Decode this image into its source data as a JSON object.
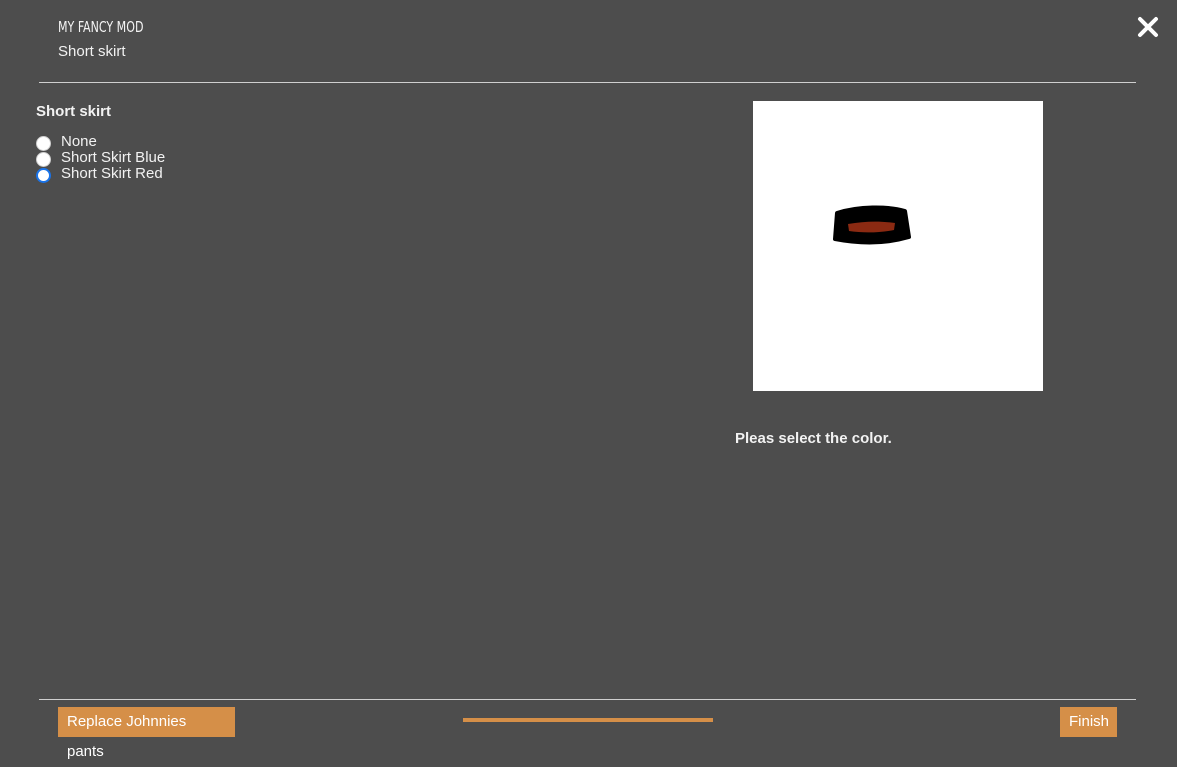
{
  "header": {
    "title": "My Fancy Mod",
    "subtitle": "Short skirt",
    "close_icon": "close-icon"
  },
  "group": {
    "label": "Short skirt",
    "options": [
      {
        "label": "None",
        "selected": false
      },
      {
        "label": "Short Skirt Blue",
        "selected": false
      },
      {
        "label": "Short Skirt Red",
        "selected": true
      }
    ]
  },
  "preview": {
    "description": "Pleas select the color.",
    "skirt_fill": "#8b2a12",
    "skirt_outline": "#000000"
  },
  "footer": {
    "prev_label": "Replace Johnnies pants",
    "finish_label": "Finish",
    "progress": 1.0
  },
  "colors": {
    "background": "#4d4d4d",
    "accent": "#d58f48",
    "radio_selected": "#1a73e8"
  }
}
